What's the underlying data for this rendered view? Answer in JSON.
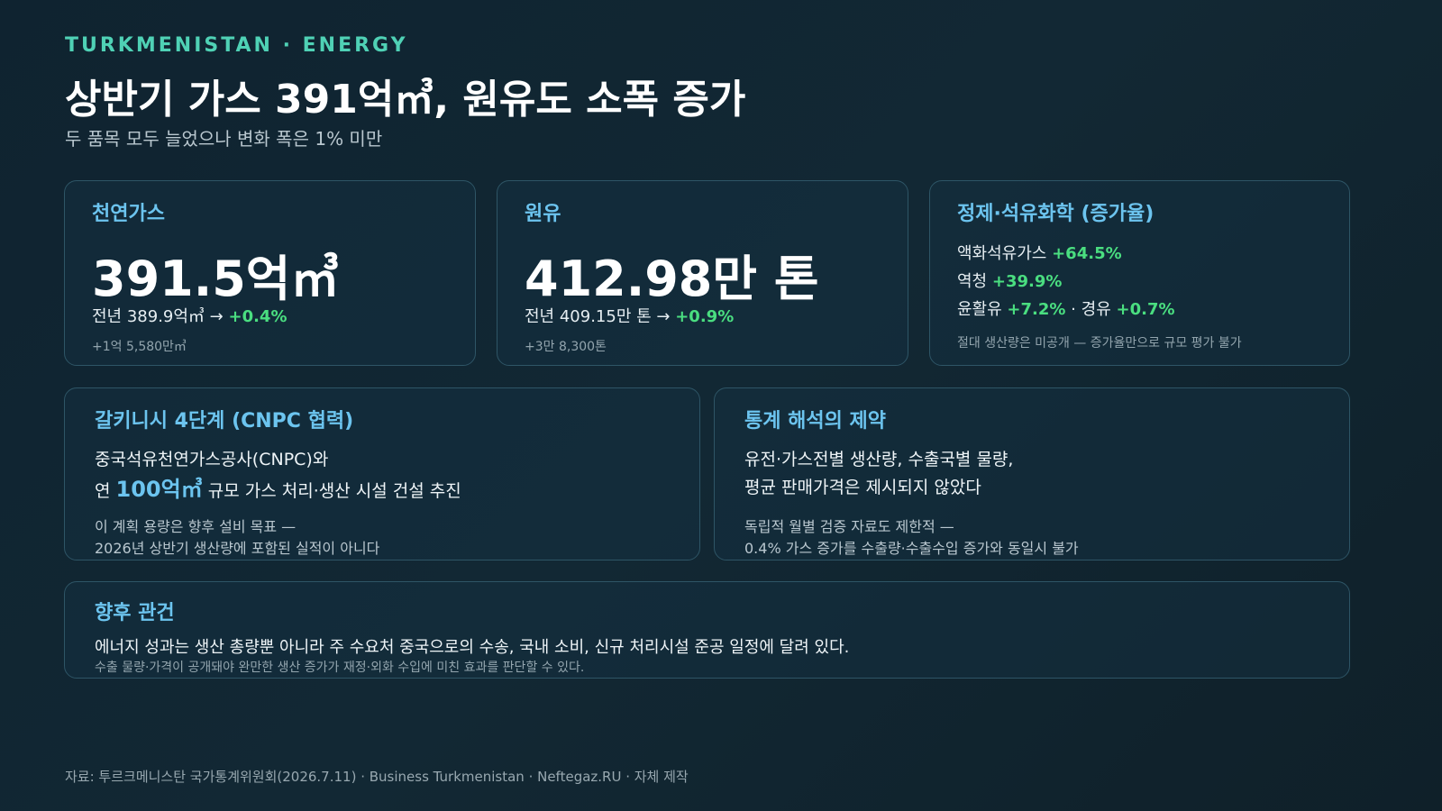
{
  "header": {
    "kicker": "TURKMENISTAN · ENERGY",
    "title": "상반기 가스 391억㎥, 원유도 소폭 증가",
    "subtitle": "두 품목 모두 늘었으나 변화 폭은 1% 미만"
  },
  "gas": {
    "label": "천연가스",
    "value": "391.5억㎥",
    "prev": "전년 389.9억㎥ →",
    "change": "+0.4%",
    "delta": "+1억 5,580만㎥"
  },
  "oil": {
    "label": "원유",
    "value": "412.98만 톤",
    "prev": "전년 409.15만 톤 →",
    "change": "+0.9%",
    "delta": "+3만 8,300톤"
  },
  "refining": {
    "label": "정제·석유화학 (증가율)",
    "lpg_label": "액화석유가스",
    "lpg_change": "+64.5%",
    "asphalt_label": "역청",
    "asphalt_change": "+39.9%",
    "lube_label": "윤활유",
    "lube_change": "+7.2%",
    "diesel_label": "경유",
    "diesel_change": "+0.7%",
    "separator": "·",
    "note": "절대 생산량은 미공개 — 증가율만으로 규모 평가 불가"
  },
  "galkynysh": {
    "label": "갈키니시 4단계 (CNPC 협력)",
    "line1": "중국석유천연가스공사(CNPC)와",
    "line2_prefix": "연",
    "line2_highlight": "100억㎥",
    "line2_suffix": "규모 가스 처리·생산 시설 건설 추진",
    "note1": "이 계획 용량은 향후 설비 목표 —",
    "note2": "2026년 상반기 생산량에 포함된 실적이 아니다"
  },
  "limits": {
    "label": "통계 해석의 제약",
    "line1": "유전·가스전별 생산량, 수출국별 물량,",
    "line2": "평균 판매가격은 제시되지 않았다",
    "note1": "독립적 월별 검증 자료도 제한적 —",
    "note2": "0.4% 가스 증가를 수출량·수출수입 증가와 동일시 불가"
  },
  "outlook": {
    "label": "향후 관건",
    "line1": "에너지 성과는 생산 총량뿐 아니라 주 수요처 중국으로의 수송, 국내 소비, 신규 처리시설 준공 일정에 달려 있다.",
    "line2": "수출 물량·가격이 공개돼야 완만한 생산 증가가 재정·외화 수입에 미친 효과를 판단할 수 있다."
  },
  "footer": {
    "source": "자료: 투르크메니스탄 국가통계위원회(2026.7.11) · Business Turkmenistan · Neftegaz.RU · 자체 제작"
  }
}
